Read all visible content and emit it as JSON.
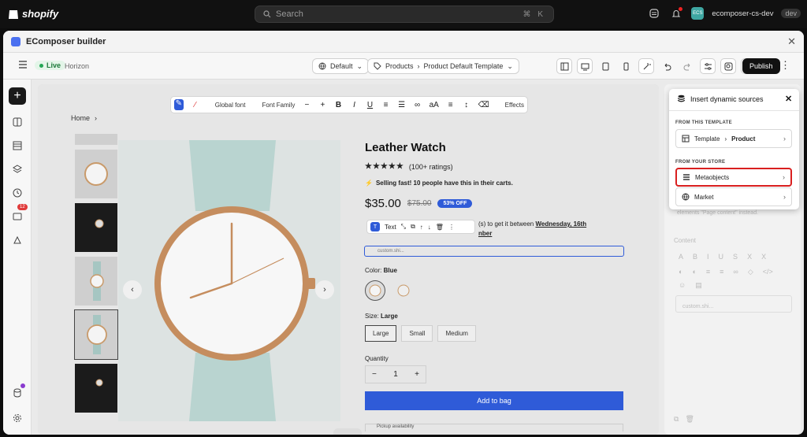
{
  "topbar": {
    "brand": "shopify",
    "search_placeholder": "Search",
    "search_shortcut": "⌘ K",
    "notification_count_visible": true,
    "store_initials": "ECS",
    "store_name": "ecomposer-cs-dev",
    "store_badge": "dev"
  },
  "modal": {
    "title": "EComposer builder"
  },
  "toolbar": {
    "live_label": "Live",
    "theme_name": "Horizon",
    "locale": "Default",
    "breadcrumb_1": "Products",
    "breadcrumb_2": "Product Default Template",
    "publish_label": "Publish"
  },
  "leftrail": {
    "badge_count": "12"
  },
  "text_toolbar": {
    "global_font": "Global font",
    "font_family": "Font Family",
    "effects": "Effects"
  },
  "page": {
    "breadcrumb_home": "Home",
    "product_title": "Leather Watch",
    "ratings": "(100+ ratings)",
    "selling_fast": "Selling fast! 10 people have this in their carts.",
    "price": "$35.00",
    "compare_price": "$75.00",
    "sale_badge": "53% OFF",
    "element_badge": "T",
    "element_label": "Text",
    "delivery_text_1": "(s) to get it between ",
    "delivery_date_1": "Wednesday, 16th",
    "delivery_date_2": "nber",
    "custom_block": "custom.shi...",
    "color_label": "Color:",
    "color_value": "Blue",
    "size_label": "Size:",
    "size_value": "Large",
    "sizes": [
      "Large",
      "Small",
      "Medium"
    ],
    "quantity_label": "Quantity",
    "quantity_value": "1",
    "add_to_bag": "Add to bag",
    "pickup_text": "Pickup availability"
  },
  "right_panel": {
    "faded_hint": "elements \"Page content\" instead.",
    "content_label": "Content",
    "custom_chip": "custom.shi..."
  },
  "dynamic_sources": {
    "title": "Insert dynamic sources",
    "section_template": "FROM THIS TEMPLATE",
    "template_item": "Template",
    "template_item_bold": "Product",
    "section_store": "FROM YOUR STORE",
    "metaobjects": "Metaobjects",
    "market": "Market"
  },
  "colors": {
    "accent_blue": "#2f5bd8",
    "highlight_red": "#d91f1f",
    "live_green": "#22a653"
  }
}
